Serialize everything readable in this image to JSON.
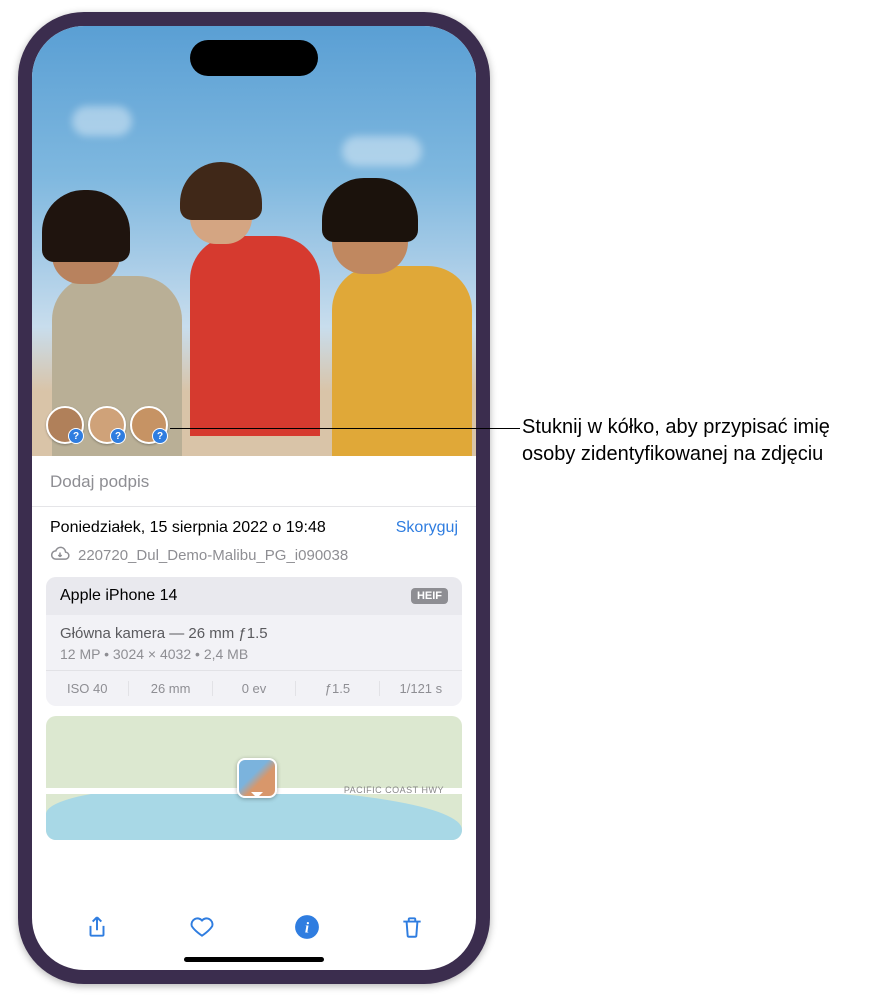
{
  "photo": {
    "caption_placeholder": "Dodaj podpis",
    "faces": [
      {
        "id": "face-1",
        "badge": "?"
      },
      {
        "id": "face-2",
        "badge": "?"
      },
      {
        "id": "face-3",
        "badge": "?"
      }
    ]
  },
  "meta": {
    "datetime": "Poniedziałek, 15 sierpnia 2022 o 19:48",
    "adjust_label": "Skoryguj",
    "filename": "220720_Dul_Demo-Malibu_PG_i090038"
  },
  "info": {
    "device": "Apple iPhone 14",
    "format_badge": "HEIF",
    "camera": "Główna kamera — 26 mm ƒ1.5",
    "specs": "12 MP  •  3024 × 4032  •  2,4 MB",
    "exif": {
      "iso": "ISO 40",
      "focal": "26 mm",
      "ev": "0 ev",
      "aperture": "ƒ1.5",
      "shutter": "1/121 s"
    }
  },
  "map": {
    "road_label": "PACIFIC COAST HWY"
  },
  "callout": {
    "text": "Stuknij w kółko, aby przypisać imię osoby zidentyfikowanej na zdjęciu"
  }
}
